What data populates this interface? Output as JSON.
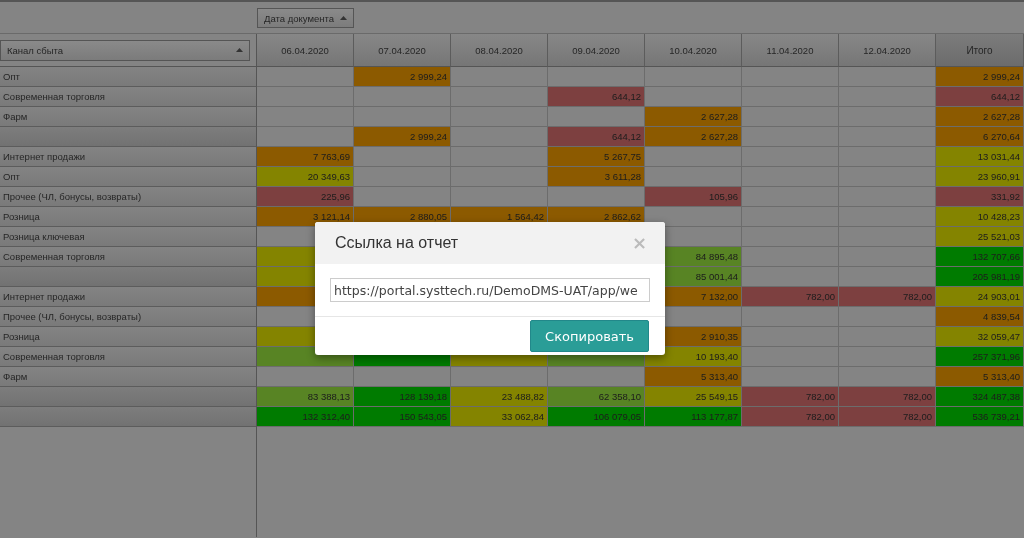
{
  "date_field_button": {
    "label": "Дата документа"
  },
  "row_field_dropdown": {
    "label": "Канал сбыта"
  },
  "columns": [
    "06.04.2020",
    "07.04.2020",
    "08.04.2020",
    "09.04.2020",
    "10.04.2020",
    "11.04.2020",
    "12.04.2020",
    "Итого"
  ],
  "rows": [
    {
      "label": "Опт",
      "cells": [
        null,
        {
          "value": "2 999,24",
          "color": "#8c5a00"
        },
        null,
        null,
        null,
        null,
        null,
        {
          "value": "2 999,24",
          "color": "#8c5a00"
        }
      ]
    },
    {
      "label": "Современная торговля",
      "cells": [
        null,
        null,
        null,
        {
          "value": "644,12",
          "color": "#7d4040"
        },
        null,
        null,
        null,
        {
          "value": "644,12",
          "color": "#7d4040"
        }
      ]
    },
    {
      "label": "Фарм",
      "cells": [
        null,
        null,
        null,
        null,
        {
          "value": "2 627,28",
          "color": "#8c5a00"
        },
        null,
        null,
        {
          "value": "2 627,28",
          "color": "#8c5a00"
        }
      ]
    },
    {
      "cells": [
        null,
        {
          "value": "2 999,24",
          "color": "#8c5a00"
        },
        null,
        {
          "value": "644,12",
          "color": "#7d4040"
        },
        {
          "value": "2 627,28",
          "color": "#8c5a00"
        },
        null,
        null,
        {
          "value": "6 270,64",
          "color": "#8c5a00"
        }
      ]
    },
    {
      "label": "Интернет продажи",
      "cells": [
        {
          "value": "7 763,69",
          "color": "#8c5a00"
        },
        null,
        null,
        {
          "value": "5 267,75",
          "color": "#8c5a00"
        },
        null,
        null,
        null,
        {
          "value": "13 031,44",
          "color": "#848400"
        }
      ]
    },
    {
      "label": "Опт",
      "cells": [
        {
          "value": "20 349,63",
          "color": "#848400"
        },
        null,
        null,
        {
          "value": "3 611,28",
          "color": "#8c5a00"
        },
        null,
        null,
        null,
        {
          "value": "23 960,91",
          "color": "#848400"
        }
      ]
    },
    {
      "label": "Прочее (ЧЛ, бонусы, возвраты)",
      "cells": [
        {
          "value": "225,96",
          "color": "#7d4040"
        },
        null,
        null,
        null,
        {
          "value": "105,96",
          "color": "#7d4040"
        },
        null,
        null,
        {
          "value": "331,92",
          "color": "#7d4040"
        }
      ]
    },
    {
      "label": "Розница",
      "cells": [
        {
          "value": "3 121,14",
          "color": "#8c5a00"
        },
        {
          "value": "2 880,05",
          "color": "#8c5a00"
        },
        {
          "value": "1 564,42",
          "color": "#8c5a00"
        },
        {
          "value": "2 862,62",
          "color": "#8c5a00"
        },
        null,
        null,
        null,
        {
          "value": "10 428,23",
          "color": "#848400"
        }
      ]
    },
    {
      "label": "Розница ключевая",
      "cells": [
        null,
        null,
        null,
        null,
        null,
        null,
        null,
        {
          "value": "25 521,03",
          "color": "#848400"
        }
      ]
    },
    {
      "label": "Современная торговля",
      "cells": [
        {
          "color": "#848400"
        },
        null,
        null,
        null,
        {
          "value": "84 895,48",
          "color": "#588424"
        },
        null,
        null,
        {
          "value": "132 707,66",
          "color": "#007b00"
        }
      ]
    },
    {
      "cells": [
        {
          "color": "#848400"
        },
        null,
        null,
        null,
        {
          "value": "85 001,44",
          "color": "#588424"
        },
        null,
        null,
        {
          "value": "205 981,19",
          "color": "#007b00"
        }
      ]
    },
    {
      "label": "Интернет продажи",
      "cells": [
        {
          "color": "#8c5a00"
        },
        null,
        null,
        null,
        {
          "value": "7 132,00",
          "color": "#8c5a00"
        },
        {
          "value": "782,00",
          "color": "#7d4040"
        },
        {
          "value": "782,00",
          "color": "#7d4040"
        },
        {
          "value": "24 903,01",
          "color": "#848400"
        }
      ]
    },
    {
      "label": "Прочее (ЧЛ, бонусы, возвраты)",
      "cells": [
        null,
        null,
        null,
        null,
        null,
        null,
        null,
        {
          "value": "4 839,54",
          "color": "#8c5a00"
        }
      ]
    },
    {
      "label": "Розница",
      "cells": [
        {
          "color": "#848400"
        },
        null,
        null,
        null,
        {
          "value": "2 910,35",
          "color": "#8c5a00"
        },
        null,
        null,
        {
          "value": "32 059,47",
          "color": "#848400"
        }
      ]
    },
    {
      "label": "Современная торговля",
      "cells": [
        {
          "color": "#588424"
        },
        {
          "color": "#007b00"
        },
        {
          "color": "#848400"
        },
        {
          "color": "#588424"
        },
        {
          "value": "10 193,40",
          "color": "#848400"
        },
        null,
        null,
        {
          "value": "257 371,96",
          "color": "#007b00"
        }
      ]
    },
    {
      "label": "Фарм",
      "cells": [
        null,
        null,
        null,
        null,
        {
          "value": "5 313,40",
          "color": "#8c5a00"
        },
        null,
        null,
        {
          "value": "5 313,40",
          "color": "#8c5a00"
        }
      ]
    },
    {
      "cells": [
        {
          "value": "83 388,13",
          "color": "#588424"
        },
        {
          "value": "128 139,18",
          "color": "#007b00"
        },
        {
          "value": "23 488,82",
          "color": "#848400"
        },
        {
          "value": "62 358,10",
          "color": "#588424"
        },
        {
          "value": "25 549,15",
          "color": "#848400"
        },
        {
          "value": "782,00",
          "color": "#7d4040"
        },
        {
          "value": "782,00",
          "color": "#7d4040"
        },
        {
          "value": "324 487,38",
          "color": "#007b00"
        }
      ]
    },
    {
      "cells": [
        {
          "value": "132 312,40",
          "color": "#007b00"
        },
        {
          "value": "150 543,05",
          "color": "#007b00"
        },
        {
          "value": "33 062,84",
          "color": "#848400"
        },
        {
          "value": "106 079,05",
          "color": "#007b00"
        },
        {
          "value": "113 177,87",
          "color": "#007b00"
        },
        {
          "value": "782,00",
          "color": "#7d4040"
        },
        {
          "value": "782,00",
          "color": "#7d4040"
        },
        {
          "value": "536 739,21",
          "color": "#007b00"
        }
      ]
    }
  ],
  "dialog": {
    "title": "Ссылка на отчет",
    "close": "×",
    "link_field": {
      "value": "https://portal.systtech.ru/DemoDMS-UAT/app/we"
    },
    "copy_button": "Скопировать"
  }
}
